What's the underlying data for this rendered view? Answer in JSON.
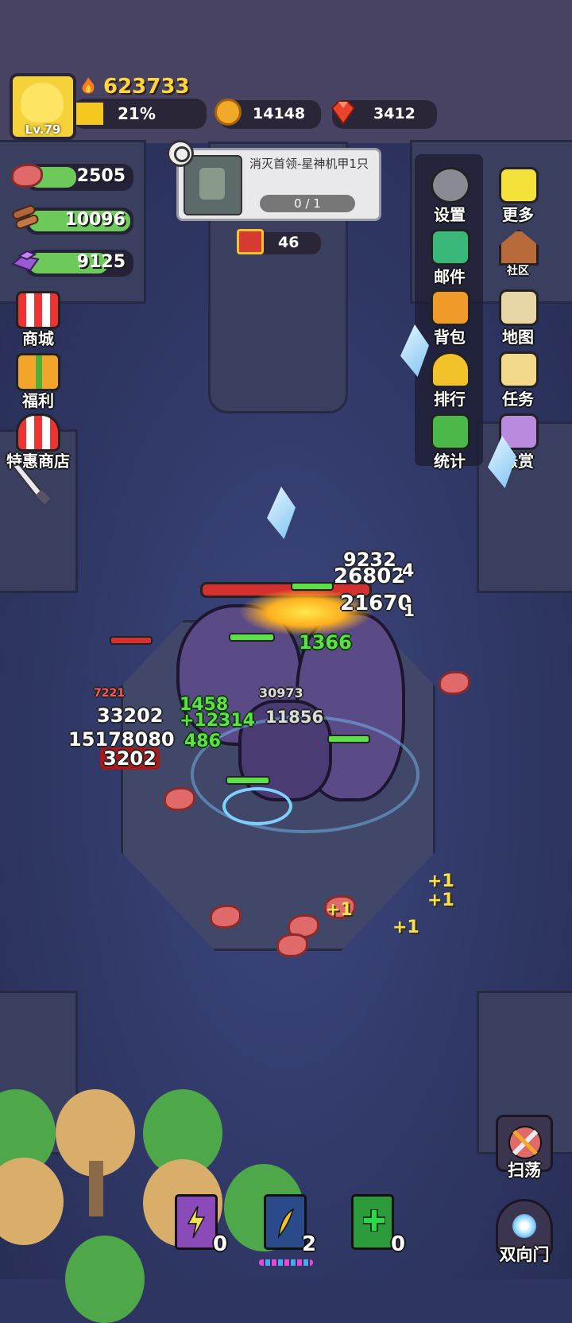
{
  "player": {
    "level": "Lv.79",
    "power": "623733",
    "xp_percent": "21%",
    "xp_fraction": 0.21
  },
  "currency": {
    "coins": "14148",
    "gems": "3412"
  },
  "resources": {
    "meat": "2505",
    "wood": "10096",
    "ore": "9125"
  },
  "quest": {
    "title": "消灭首领-星神机甲1只",
    "progress": "0 / 1",
    "chest_count": "46"
  },
  "left_menu": [
    {
      "label": "商城",
      "icon": "shop-stall-icon"
    },
    {
      "label": "福利",
      "icon": "gift-box-icon"
    },
    {
      "label": "特惠商店",
      "icon": "special-shop-icon"
    }
  ],
  "right_menu": [
    {
      "label": "设置",
      "icon": "gear-icon"
    },
    {
      "label": "更多",
      "icon": "more-cards-icon"
    },
    {
      "label": "邮件",
      "icon": "mail-icon"
    },
    {
      "label": "社区",
      "icon": "house-icon"
    },
    {
      "label": "背包",
      "icon": "backpack-icon"
    },
    {
      "label": "地图",
      "icon": "map-icon"
    },
    {
      "label": "排行",
      "icon": "trophy-icon"
    },
    {
      "label": "任务",
      "icon": "quest-scroll-icon"
    },
    {
      "label": "统计",
      "icon": "book-icon"
    },
    {
      "label": "悬赏",
      "icon": "bounty-icon"
    }
  ],
  "damage_numbers": {
    "d1": "9232",
    "d2": "26802",
    "d3": "4",
    "d4": "21670",
    "d5": "1",
    "d6": "1366",
    "d7": "7221",
    "d8": "1458",
    "d9": "30973",
    "d10": "33202",
    "d11": "+12314",
    "d12": "11856",
    "d13": "15178080",
    "d14": "486",
    "d15": "3202"
  },
  "pickups": [
    "+1",
    "+1",
    "+1",
    "+1"
  ],
  "skills": [
    {
      "icon": "lightning-book-icon",
      "count": "0",
      "color": "#8a4ab8"
    },
    {
      "icon": "wing-book-icon",
      "count": "2",
      "color": "#2a4a8a"
    },
    {
      "icon": "heal-book-icon",
      "count": "0",
      "color": "#2a9a3a"
    }
  ],
  "action_buttons": {
    "sweep": "扫荡",
    "portal": "双向门"
  },
  "colors": {
    "health_bar": "#d43030",
    "hp_green": "#5de04a",
    "accent_gold": "#ffd53a"
  }
}
